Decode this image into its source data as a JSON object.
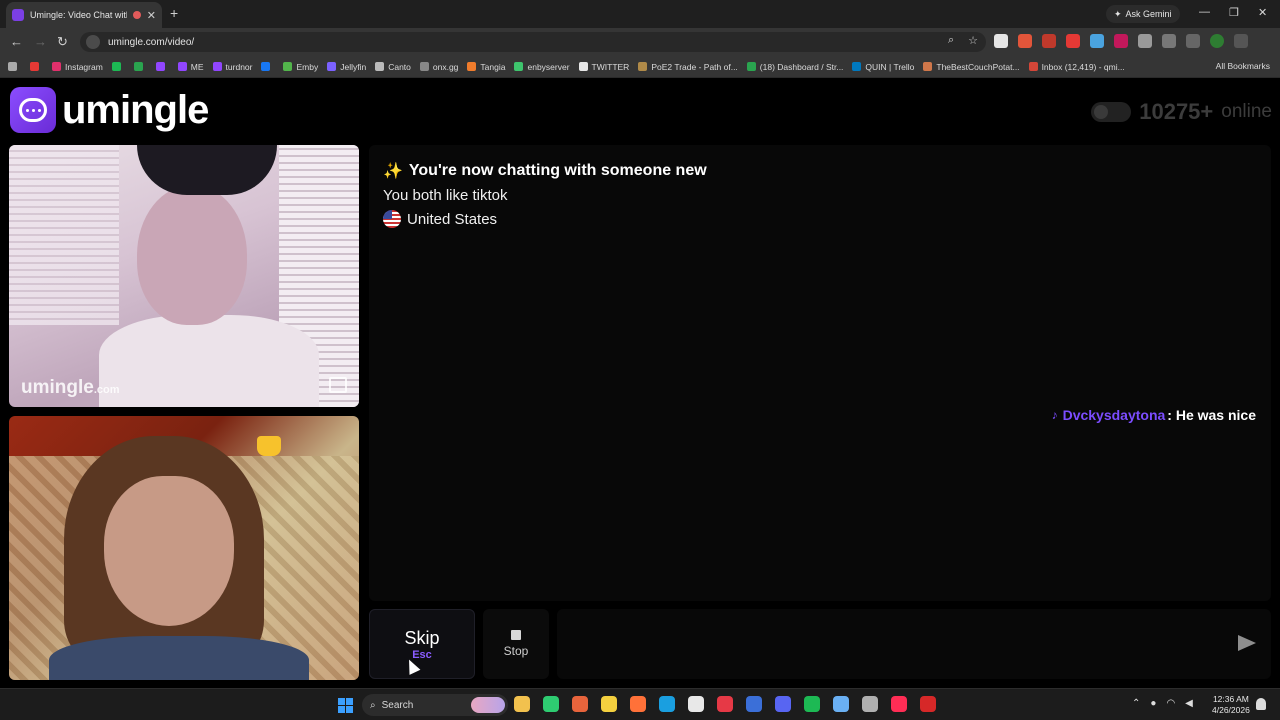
{
  "browser": {
    "tab_title": "Umingle: Video Chat with S",
    "tab_close": "✕",
    "new_tab": "+",
    "ask_gemini": "Ask Gemini",
    "url": "umingle.com/video/",
    "all_bookmarks": "All Bookmarks",
    "bookmarks": [
      {
        "label": "Instagram",
        "color": "#e1306c"
      },
      {
        "label": "",
        "color": "#1db954"
      },
      {
        "label": "",
        "color": "#2aa44f"
      },
      {
        "label": "",
        "color": "#9146ff"
      },
      {
        "label": "ME",
        "color": "#9146ff"
      },
      {
        "label": "turdnor",
        "color": "#9146ff"
      },
      {
        "label": "",
        "color": "#1877f2"
      },
      {
        "label": "Emby",
        "color": "#52b54b"
      },
      {
        "label": "Jellyfin",
        "color": "#7b61ff"
      },
      {
        "label": "Canto",
        "color": "#bbbbbb"
      },
      {
        "label": "onx.gg",
        "color": "#888888"
      },
      {
        "label": "Tangia",
        "color": "#f07c2c"
      },
      {
        "label": "enbyserver",
        "color": "#3ec46d"
      },
      {
        "label": "TWITTER",
        "color": "#e7e7e7"
      },
      {
        "label": "PoE2 Trade - Path of...",
        "color": "#b08a48"
      },
      {
        "label": "(18) Dashboard / Str...",
        "color": "#2aa44f"
      },
      {
        "label": "QUIN | Trello",
        "color": "#0079bf"
      },
      {
        "label": "TheBestCouchPotat...",
        "color": "#d0774a"
      },
      {
        "label": "Inbox (12,419) - qmi...",
        "color": "#d44638"
      }
    ]
  },
  "page": {
    "logo_text": "umingle",
    "online_count": "10275",
    "online_plus": "+",
    "online_label": "online",
    "watermark_main": "umingle",
    "watermark_tld": ".com",
    "chat": {
      "sparkle": "✨",
      "header": "You're now chatting with someone new",
      "interest": "You both like tiktok",
      "country": "United States",
      "message_user": "Dvckysdaytona",
      "message_text": ": He was nice"
    },
    "skip_label": "Skip",
    "skip_key": "Esc",
    "stop_label": "Stop",
    "input_placeholder": ""
  },
  "taskbar": {
    "search_label": "Search",
    "time": "12:36 AM",
    "date": "4/26/2026",
    "apps": [
      "#f2c14e",
      "#2ecc71",
      "#e8643c",
      "#f4d03f",
      "#ff7139",
      "#1a9fe0",
      "#e8e8e8",
      "#e63946",
      "#3b6fd8",
      "#5865f2",
      "#1db954",
      "#6ab0f3",
      "#b0b0b0",
      "#ff2d55",
      "#d62828"
    ]
  },
  "colors": {
    "accent": "#7c4dff",
    "background": "#000000",
    "panel": "#080808"
  }
}
